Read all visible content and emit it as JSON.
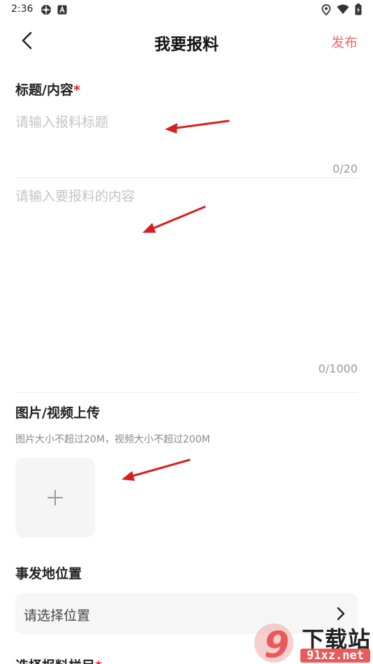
{
  "status_bar": {
    "time": "2:36",
    "left_icons": [
      "app-badge-icon",
      "a-box-icon"
    ],
    "right_icons": [
      "location-pin-icon",
      "wifi-icon",
      "battery-icon"
    ]
  },
  "header": {
    "title": "我要报料",
    "publish_label": "发布",
    "back_icon": "chevron-left-icon"
  },
  "title_section": {
    "label": "标题/内容",
    "required_mark": "*",
    "title_placeholder": "请输入报料标题",
    "title_counter": "0/20",
    "content_placeholder": "请输入要报料的内容",
    "content_counter": "0/1000"
  },
  "upload_section": {
    "label": "图片/视频上传",
    "hint": "图片大小不超过20M，视频大小不超过200M",
    "add_icon": "plus-icon"
  },
  "location_section": {
    "label": "事发地位置",
    "placeholder": "请选择位置",
    "chevron_icon": "chevron-right-icon"
  },
  "column_section": {
    "label": "选择报料栏目",
    "required_mark": "*"
  },
  "watermark": {
    "main_text": "下载站",
    "sub_text": "91xz.net",
    "logo_text": "9"
  },
  "colors": {
    "accent": "#f26a6a",
    "required": "#e02020",
    "annotation_arrow": "#d81e1e",
    "placeholder": "#c4c4c4"
  }
}
